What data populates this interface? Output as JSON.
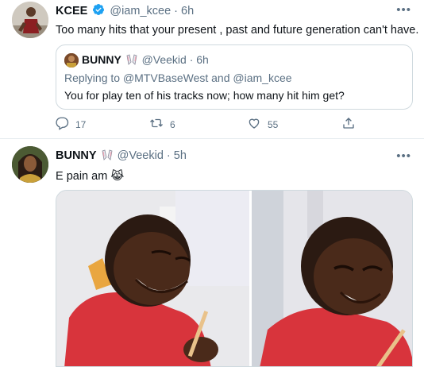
{
  "tweet1": {
    "author_name": "KCEE",
    "author_handle": "@iam_kcee",
    "separator": "·",
    "time": "6h",
    "more": "•••",
    "text": "Too many hits that your present , past and future generation can't have.",
    "quote": {
      "author_name": "BUNNY",
      "author_handle": "@Veekid",
      "separator": "·",
      "time": "6h",
      "replying_prefix": "Replying to",
      "reply_user_1": "@MTVBaseWest",
      "reply_and": "and",
      "reply_user_2": "@iam_kcee",
      "text": "You for play ten of his tracks now; how many hit him get?"
    },
    "actions": {
      "reply_count": "17",
      "retweet_count": "6",
      "like_count": "55"
    }
  },
  "tweet2": {
    "author_name": "BUNNY",
    "author_handle": "@Veekid",
    "separator": "·",
    "time": "5h",
    "more": "•••",
    "text": "E pain am",
    "emoji": "😹"
  },
  "colors": {
    "secondary_text": "#5b7083",
    "border": "#cfd9de",
    "verified": "#1da1f2",
    "shirt_red": "#d8343c"
  },
  "icons": [
    "verified-badge-icon",
    "rabbit-emoji-icon",
    "reply-icon",
    "retweet-icon",
    "like-icon",
    "share-icon",
    "more-icon",
    "crying-laughing-cat-emoji"
  ]
}
